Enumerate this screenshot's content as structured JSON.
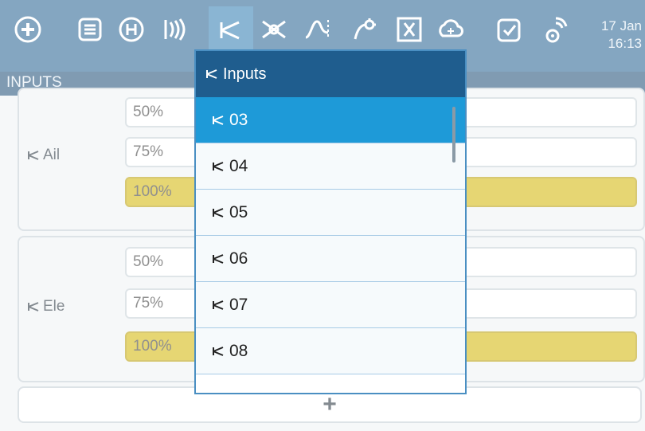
{
  "topbar": {
    "icons": [
      "add-icon",
      "list-icon",
      "heli-icon",
      "sound-icon",
      "inputs-icon",
      "mixer-icon",
      "curve-icon",
      "logical-switch-icon",
      "variable-icon",
      "special-functions-icon",
      "checklist-icon",
      "telemetry-icon"
    ],
    "date": "17 Jan",
    "time": "16:13"
  },
  "page": {
    "title": "INPUTS"
  },
  "groups": [
    {
      "name": "Ail",
      "lines": [
        "50%",
        "75%",
        "100%"
      ],
      "highlight_index": 2
    },
    {
      "name": "Ele",
      "lines": [
        "50%",
        "75%",
        "100%"
      ],
      "highlight_index": 2
    }
  ],
  "add_button": {
    "label": "+"
  },
  "popup": {
    "title": "Inputs",
    "items": [
      "03",
      "04",
      "05",
      "06",
      "07",
      "08"
    ],
    "selected_index": 0
  },
  "colors": {
    "topbar": "#1f5d8e",
    "header": "#184a73",
    "selected": "#1e9ad8",
    "highlight": "#d2b400"
  }
}
